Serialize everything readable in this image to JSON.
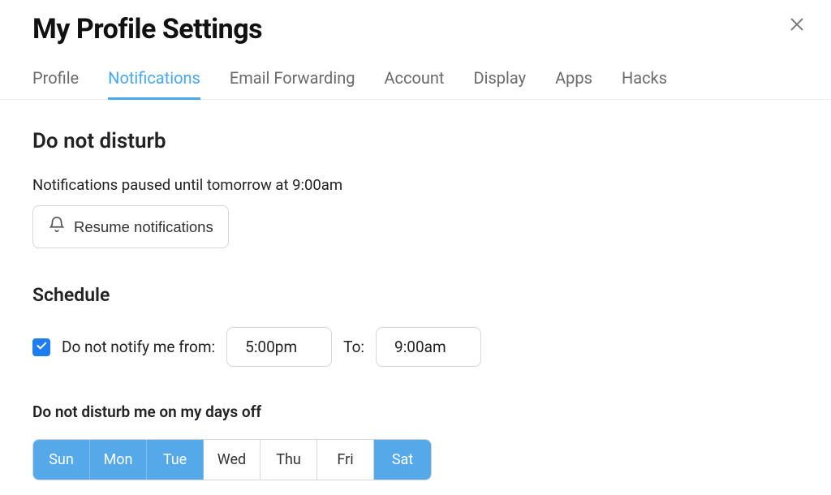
{
  "page_title": "My Profile Settings",
  "tabs": [
    {
      "label": "Profile",
      "active": false
    },
    {
      "label": "Notifications",
      "active": true
    },
    {
      "label": "Email Forwarding",
      "active": false
    },
    {
      "label": "Account",
      "active": false
    },
    {
      "label": "Display",
      "active": false
    },
    {
      "label": "Apps",
      "active": false
    },
    {
      "label": "Hacks",
      "active": false
    }
  ],
  "dnd": {
    "section_title": "Do not disturb",
    "status_text": "Notifications paused until tomorrow at 9:00am",
    "resume_label": "Resume notifications"
  },
  "schedule": {
    "title": "Schedule",
    "checkbox_checked": true,
    "from_label": "Do not notify me from:",
    "from_value": "5:00pm",
    "to_label": "To:",
    "to_value": "9:00am"
  },
  "days_off": {
    "label": "Do not disturb me on my days off",
    "days": [
      {
        "label": "Sun",
        "selected": true
      },
      {
        "label": "Mon",
        "selected": true
      },
      {
        "label": "Tue",
        "selected": true
      },
      {
        "label": "Wed",
        "selected": false
      },
      {
        "label": "Thu",
        "selected": false
      },
      {
        "label": "Fri",
        "selected": false
      },
      {
        "label": "Sat",
        "selected": true
      }
    ]
  }
}
